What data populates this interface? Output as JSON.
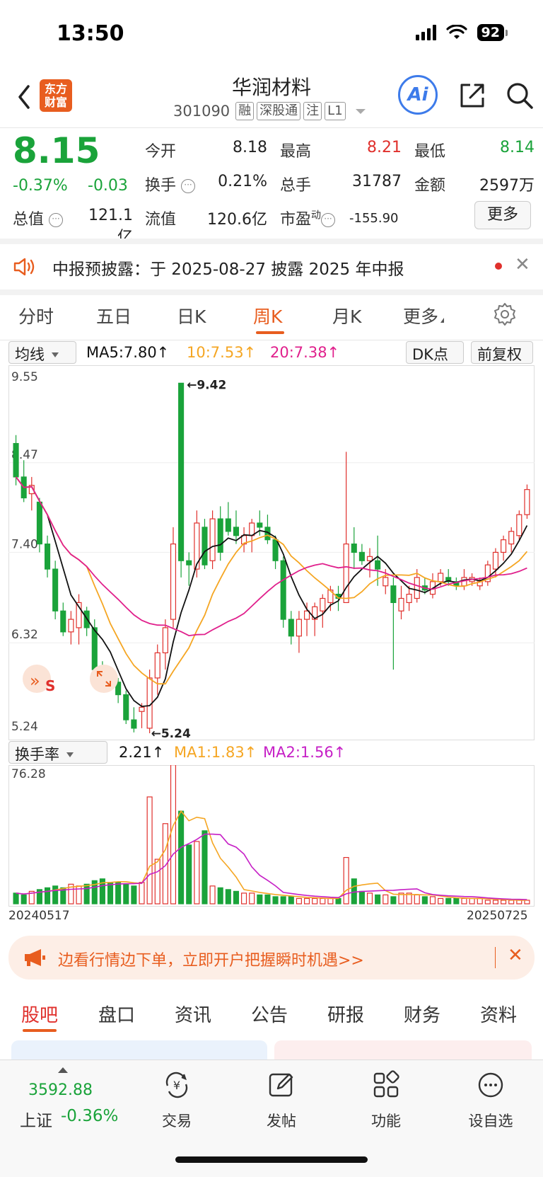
{
  "status": {
    "time": "13:50",
    "battery": "92"
  },
  "header": {
    "name": "华润材料",
    "code": "301090",
    "tags": [
      "融",
      "深股通",
      "注",
      "L1"
    ],
    "logo_line1": "东方",
    "logo_line2": "财富",
    "ai_label": "Ai"
  },
  "quote": {
    "price": "8.15",
    "change_pct": "-0.37%",
    "change_val": "-0.03",
    "open_label": "今开",
    "open": "8.18",
    "high_label": "最高",
    "high": "8.21",
    "low_label": "最低",
    "low": "8.14",
    "turnover_label": "换手",
    "turnover": "0.21%",
    "volume_label": "总手",
    "volume": "31787",
    "amount_label": "金额",
    "amount": "2597万",
    "total_cap_label": "总值",
    "total_cap": "121.1亿",
    "float_cap_label": "流值",
    "float_cap": "120.6亿",
    "pe_label": "市盈",
    "pe_sup": "动",
    "pe": "-155.90",
    "more": "更多"
  },
  "notice": {
    "text": "中报预披露：于 2025-08-27 披露 2025 年中报"
  },
  "period_tabs": [
    "分时",
    "五日",
    "日K",
    "周K",
    "月K",
    "更多"
  ],
  "active_period": "周K",
  "ma_bar": {
    "dropdown": "均线",
    "ma5": "MA5:7.80↑",
    "ma10": "10:7.53↑",
    "ma20": "20:7.38↑",
    "dk": "DK点",
    "adjust": "前复权"
  },
  "vol_bar": {
    "dropdown": "换手率",
    "value": "2.21↑",
    "ma1": "MA1:1.83↑",
    "ma2": "MA2:1.56↑"
  },
  "colors": {
    "up": "#e0302c",
    "down": "#1aa33a",
    "ma5": "#111111",
    "ma10": "#f5a623",
    "ma20": "#e0208c",
    "accent": "#e85d1f"
  },
  "chart_data": [
    {
      "type": "candlestick",
      "title": "",
      "y_axis_labels": [
        "9.55",
        "8.47",
        "7.40",
        "6.32",
        "5.24"
      ],
      "annotations": [
        "←9.42",
        "←5.24"
      ],
      "ylim": [
        5.24,
        9.55
      ],
      "series": [
        {
          "name": "MA5",
          "last": 7.8
        },
        {
          "name": "10",
          "last": 7.53
        },
        {
          "name": "20",
          "last": 7.38
        }
      ],
      "candles": [
        [
          8.7,
          8.8,
          8.2,
          8.3
        ],
        [
          8.3,
          8.5,
          8.0,
          8.05
        ],
        [
          8.1,
          8.3,
          7.9,
          8.2
        ],
        [
          8.0,
          8.05,
          7.4,
          7.5
        ],
        [
          7.5,
          7.6,
          7.1,
          7.2
        ],
        [
          7.2,
          7.3,
          6.6,
          6.7
        ],
        [
          6.7,
          6.8,
          6.4,
          6.45
        ],
        [
          6.45,
          6.7,
          6.3,
          6.6
        ],
        [
          6.5,
          6.9,
          6.3,
          6.8
        ],
        [
          6.7,
          6.75,
          6.4,
          6.5
        ],
        [
          6.5,
          6.6,
          5.9,
          6.0
        ],
        [
          6.0,
          6.1,
          5.8,
          5.9
        ],
        [
          5.9,
          6.0,
          5.75,
          5.85
        ],
        [
          5.85,
          5.9,
          5.6,
          5.7
        ],
        [
          5.7,
          5.75,
          5.35,
          5.4
        ],
        [
          5.4,
          5.55,
          5.25,
          5.3
        ],
        [
          5.5,
          5.6,
          5.3,
          5.55
        ],
        [
          5.3,
          6.0,
          5.24,
          5.9
        ],
        [
          5.9,
          6.3,
          5.7,
          6.2
        ],
        [
          6.2,
          6.6,
          6.0,
          6.5
        ],
        [
          6.6,
          7.7,
          6.5,
          7.5
        ],
        [
          9.42,
          9.42,
          7.1,
          7.3
        ],
        [
          7.3,
          7.4,
          7.0,
          7.25
        ],
        [
          7.2,
          7.9,
          7.1,
          7.75
        ],
        [
          7.7,
          7.8,
          7.2,
          7.25
        ],
        [
          7.3,
          7.9,
          7.2,
          7.8
        ],
        [
          7.8,
          7.95,
          7.3,
          7.4
        ],
        [
          7.8,
          8.0,
          7.6,
          7.65
        ],
        [
          7.7,
          7.9,
          7.5,
          7.6
        ],
        [
          7.5,
          7.7,
          7.4,
          7.6
        ],
        [
          7.6,
          7.8,
          7.4,
          7.75
        ],
        [
          7.75,
          7.9,
          7.6,
          7.7
        ],
        [
          7.7,
          7.85,
          7.5,
          7.55
        ],
        [
          7.55,
          7.6,
          7.2,
          7.3
        ],
        [
          7.3,
          7.35,
          6.5,
          6.6
        ],
        [
          6.6,
          6.7,
          6.3,
          6.4
        ],
        [
          6.4,
          6.7,
          6.2,
          6.6
        ],
        [
          6.6,
          6.8,
          6.4,
          6.7
        ],
        [
          6.6,
          6.8,
          6.4,
          6.75
        ],
        [
          6.7,
          6.9,
          6.5,
          6.85
        ],
        [
          6.8,
          7.0,
          6.7,
          6.95
        ],
        [
          6.9,
          7.0,
          6.7,
          6.85
        ],
        [
          6.8,
          8.6,
          6.8,
          7.5
        ],
        [
          7.5,
          7.7,
          7.2,
          7.4
        ],
        [
          7.4,
          7.5,
          7.25,
          7.3
        ],
        [
          7.3,
          7.45,
          7.1,
          7.35
        ],
        [
          7.3,
          7.6,
          7.0,
          7.2
        ],
        [
          7.0,
          7.2,
          6.9,
          7.1
        ],
        [
          7.0,
          7.1,
          6.0,
          6.8
        ],
        [
          6.7,
          7.0,
          6.6,
          6.85
        ],
        [
          6.8,
          7.0,
          6.7,
          6.9
        ],
        [
          6.85,
          7.2,
          6.8,
          7.1
        ],
        [
          7.0,
          7.1,
          6.9,
          6.95
        ],
        [
          6.9,
          7.15,
          6.85,
          7.05
        ],
        [
          7.05,
          7.2,
          7.0,
          7.15
        ],
        [
          7.1,
          7.2,
          7.0,
          7.05
        ],
        [
          7.05,
          7.1,
          6.95,
          7.0
        ],
        [
          7.0,
          7.2,
          6.95,
          7.1
        ],
        [
          7.05,
          7.15,
          7.0,
          7.1
        ],
        [
          7.0,
          7.1,
          6.95,
          7.05
        ],
        [
          7.05,
          7.3,
          7.0,
          7.25
        ],
        [
          7.2,
          7.45,
          7.1,
          7.4
        ],
        [
          7.4,
          7.6,
          7.3,
          7.55
        ],
        [
          7.5,
          7.7,
          7.4,
          7.65
        ],
        [
          7.6,
          7.9,
          7.55,
          7.85
        ],
        [
          7.85,
          8.21,
          7.8,
          8.15
        ]
      ]
    },
    {
      "type": "bar",
      "title": "",
      "y_axis_labels": [
        "76.28"
      ],
      "x_axis_labels": [
        "20240517",
        "20250725"
      ],
      "ylim": [
        0,
        76.28
      ],
      "series": [
        {
          "name": "换手率",
          "values": [
            6,
            5,
            7,
            8,
            9,
            10,
            9,
            11,
            10,
            11,
            13,
            14,
            12,
            12,
            11,
            10,
            12,
            60,
            25,
            45,
            78,
            52,
            33,
            35,
            41,
            10,
            9,
            8,
            7,
            6,
            6,
            5,
            5,
            4,
            4,
            4,
            3,
            3,
            3,
            3,
            3,
            3,
            26,
            14,
            7,
            6,
            5,
            5,
            4,
            6,
            6,
            5,
            4,
            4,
            3,
            3,
            3,
            3,
            3,
            3,
            2,
            2,
            2,
            2,
            2,
            2
          ]
        },
        {
          "name": "MA1",
          "last": 1.83
        },
        {
          "name": "MA2",
          "last": 1.56
        }
      ]
    }
  ],
  "ad": {
    "text": "边看行情边下单，立即开户把握瞬时机遇>>"
  },
  "bottom_tabs": [
    "股吧",
    "盘口",
    "资讯",
    "公告",
    "研报",
    "财务",
    "资料"
  ],
  "index": {
    "value": "3592.88",
    "name": "上证",
    "pct": "-0.36%"
  },
  "nav": {
    "trade": "交易",
    "post": "发帖",
    "func": "功能",
    "watch": "设自选"
  }
}
